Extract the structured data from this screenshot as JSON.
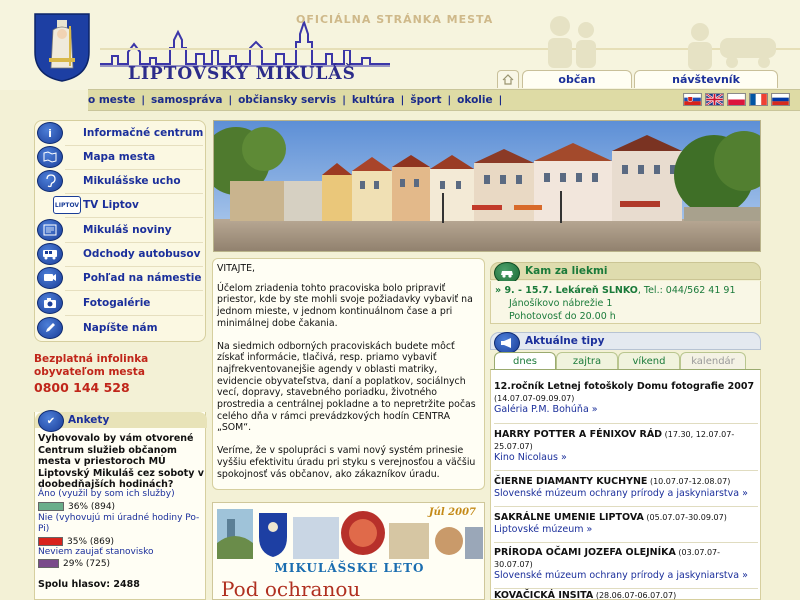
{
  "header": {
    "slogan": "OFICIÁLNA STRÁNKA MESTA",
    "city_name": "LIPTOVSKÝ MIKULÁŠ",
    "tabs": [
      {
        "label": "občan"
      },
      {
        "label": "návštevník"
      }
    ]
  },
  "nav": {
    "items": [
      {
        "label": "o meste"
      },
      {
        "label": "samospráva"
      },
      {
        "label": "občiansky servis"
      },
      {
        "label": "kultúra"
      },
      {
        "label": "šport"
      },
      {
        "label": "okolie"
      }
    ],
    "separator": "|",
    "flags": [
      {
        "icon": "flag-slovak-icon"
      },
      {
        "icon": "flag-uk-icon"
      },
      {
        "icon": "flag-polish-icon"
      },
      {
        "icon": "flag-french-icon"
      },
      {
        "icon": "flag-russian-icon"
      }
    ]
  },
  "sidebar": {
    "items": [
      {
        "label": "Informačné centrum",
        "icon": "info-icon"
      },
      {
        "label": "Mapa mesta",
        "icon": "map-icon"
      },
      {
        "label": "Mikulášske ucho",
        "icon": "ear-icon"
      },
      {
        "label": "TV Liptov",
        "icon": "tv-icon"
      },
      {
        "label": "Mikuláš noviny",
        "icon": "newspaper-icon"
      },
      {
        "label": "Odchody autobusov",
        "icon": "bus-icon"
      },
      {
        "label": "Pohľad na námestie",
        "icon": "webcam-icon"
      },
      {
        "label": "Fotogalérie",
        "icon": "camera-icon"
      },
      {
        "label": "Napíšte nám",
        "icon": "pen-icon"
      }
    ],
    "tv_logo_text": "LIPTOV"
  },
  "infolinka": {
    "line1": "Bezplatná infolinka",
    "line2": "obyvateľom mesta",
    "number": "0800 144 528"
  },
  "poll": {
    "title": "Ankety",
    "question": "Vyhovovalo by vám otvorené Centrum služieb občanom mesta v priestoroch MÚ Liptovský Mikuláš cez soboty v doobedňajších hodinách?",
    "options": [
      {
        "label": "Áno (využil by som ich služby)",
        "result": "36% (894)",
        "fraction": 0.36,
        "color": "#6aae8a"
      },
      {
        "label": "Nie (vyhovujú mi úradné hodiny Po-Pi)",
        "result": "35% (869)",
        "fraction": 0.35,
        "color": "#d8231b"
      },
      {
        "label": "Neviem zaujať stanovisko",
        "result": "29% (725)",
        "fraction": 0.29,
        "color": "#7a4a8a"
      }
    ],
    "total": "Spolu hlasov: 2488"
  },
  "welcome": {
    "title": "VITAJTE,",
    "paragraphs": [
      "Účelom zriadenia tohto pracoviska bolo pripraviť priestor, kde by ste mohli svoje požiadavky vybaviť na jednom mieste, v jednom kontinuálnom čase a pri minimálnej dobe čakania.",
      "Na siedmich odborných pracoviskách budete môcť získať informácie, tlačivá, resp. priamo vybaviť najfrekventovanejšie agendy v oblasti matriky, evidencie obyvateľstva, daní a poplatkov, sociálnych vecí, dopravy, stavebného poriadku, životného prostredia a centrálnej pokladne a to nepretržite počas celého dňa v rámci prevádzkových hodín CENTRA „SOM“.",
      "Veríme, že v spolupráci s vami nový systém prinesie vyššiu efektivitu úradu pri styku s verejnosťou a väčšiu spokojnosť vás občanov, ako zákazníkov úradu."
    ]
  },
  "banner": {
    "month": "Júl 2007",
    "title": "MIKULÁŠSKE LETO",
    "subtitle": "Pod ochranou"
  },
  "pharmacy": {
    "title": "Kam za liekmi",
    "line1_prefix": "» 9. - 15.7. Lekáreň SLNKO",
    "line1_phone": ", Tel.: 044/562 41 91",
    "line2": "Jánošíkovo nábrežie 1",
    "line3": "Pohotovosť do 20.00 h"
  },
  "tips": {
    "title": "Aktuálne tipy",
    "tabs": [
      {
        "label": "dnes"
      },
      {
        "label": "zajtra"
      },
      {
        "label": "víkend"
      },
      {
        "label": "kalendár"
      }
    ],
    "items": [
      {
        "title": "12.ročník Letnej fotoškoly Domu fotografie 2007",
        "date": " (14.07.07-09.09.07)",
        "place": "Galéria P.M. Bohúňa »"
      },
      {
        "title": "HARRY POTTER A FÉNIXOV RÁD",
        "date": " (17.30, 12.07.07-25.07.07)",
        "place": "Kino Nicolaus »"
      },
      {
        "title": "ČIERNE DIAMANTY KUCHYNE",
        "date": " (10.07.07-12.08.07)",
        "place": "Slovenské múzeum ochrany prírody a jaskyniarstva »"
      },
      {
        "title": "SAKRÁLNE UMENIE LIPTOVA",
        "date": " (05.07.07-30.09.07)",
        "place": "Liptovské múzeum »"
      },
      {
        "title": "PRÍRODA OČAMI JOZEFA OLEJNÍKA",
        "date": " (03.07.07-30.07.07)",
        "place": "Slovenské múzeum ochrany prírody a jaskyniarstva »"
      },
      {
        "title": "KOVAČICKÁ INSITA",
        "date": " (28.06.07-06.07.07)",
        "place": ""
      }
    ]
  }
}
